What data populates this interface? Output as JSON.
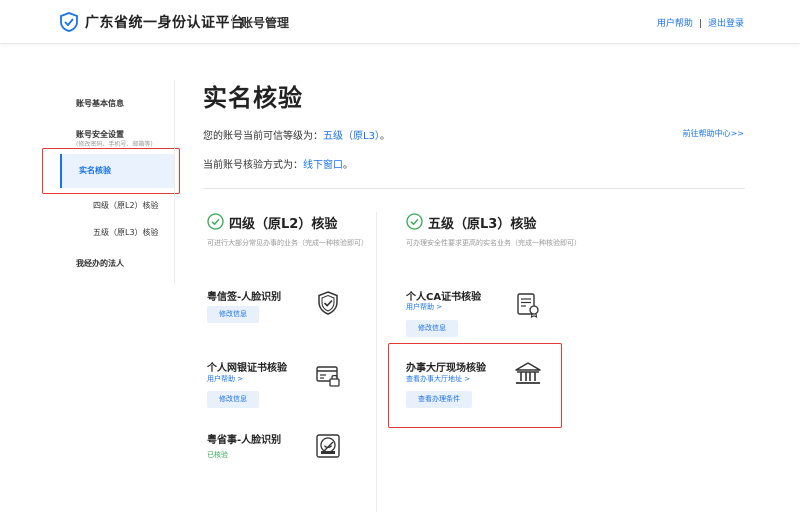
{
  "header": {
    "brand": "广东省统一身份认证平台",
    "subtitle": "账号管理",
    "links": {
      "help": "用户帮助",
      "separator": "|",
      "logout": "退出登录"
    }
  },
  "sidebar": {
    "items": [
      {
        "label": "账号基本信息"
      },
      {
        "label": "账号安全设置",
        "note": "(修改密码、手机号、邮箱等)"
      },
      {
        "label": "实名核验",
        "active": true
      },
      {
        "label": "四级（原L2）核验"
      },
      {
        "label": "五级（原L3）核验"
      },
      {
        "label": "我经办的法人"
      }
    ]
  },
  "main": {
    "title": "实名核验",
    "level_prefix": "您的账号当前可信等级为：",
    "level_value": "五级（原L3）",
    "level_suffix": "。",
    "method_prefix": "当前账号核验方式为：",
    "method_value": "线下窗口",
    "method_suffix": "。",
    "help_center": "前往帮助中心>>"
  },
  "level2": {
    "title": "四级（原L2）核验",
    "desc": "可进行大部分常见办事的业务（完成一种核验即可）",
    "items": [
      {
        "title": "粤信签-人脸识别",
        "button": "修改信息",
        "icon": "shield-check-icon"
      },
      {
        "title": "个人网银证书核验",
        "link": "用户帮助 >",
        "button": "修改信息",
        "icon": "bank-card-lock-icon"
      },
      {
        "title": "粤省事-人脸识别",
        "status": "已核验",
        "icon": "face-scan-icon"
      }
    ]
  },
  "level3": {
    "title": "五级（原L3）核验",
    "desc": "可办理安全性要求更高的实名业务（完成一种核验即可）",
    "items": [
      {
        "title": "个人CA证书核验",
        "link": "用户帮助 >",
        "button": "修改信息",
        "icon": "certificate-icon"
      },
      {
        "title": "办事大厅现场核验",
        "link": "查看办事大厅地址 >",
        "button": "查看办理条件",
        "icon": "government-hall-icon"
      }
    ]
  },
  "colors": {
    "accent": "#1a73e8",
    "success": "#34a853",
    "highlight": "#e53935",
    "active_bg": "#eaf2fd"
  }
}
